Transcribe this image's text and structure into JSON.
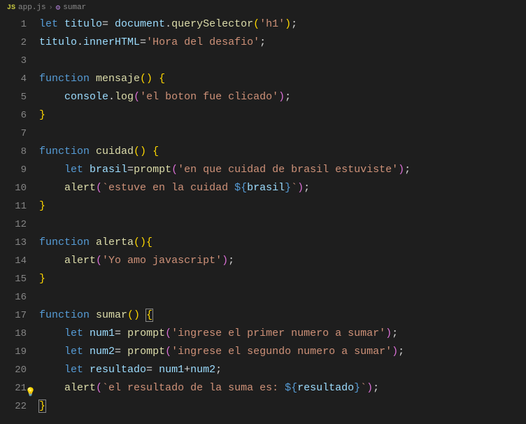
{
  "breadcrumb": {
    "file_icon": "JS",
    "file": "app.js",
    "sep": "›",
    "symbol_icon": "⚙",
    "symbol": "sumar"
  },
  "gutter": {
    "lines": [
      "1",
      "2",
      "3",
      "4",
      "5",
      "6",
      "7",
      "8",
      "9",
      "10",
      "11",
      "12",
      "13",
      "14",
      "15",
      "16",
      "17",
      "18",
      "19",
      "20",
      "21",
      "22"
    ]
  },
  "code": {
    "l1": {
      "let": "let ",
      "titulo": "titulo",
      "eq": "= ",
      "document": "document",
      "dot": ".",
      "qs": "querySelector",
      "lp": "(",
      "str": "'h1'",
      "rp": ")",
      "semi": ";"
    },
    "l2": {
      "titulo": "titulo",
      "dot": ".",
      "inner": "innerHTML",
      "eq": "=",
      "str": "'Hora del desafio'",
      "semi": ";"
    },
    "l4": {
      "fn": "function ",
      "name": "mensaje",
      "lp": "()",
      "sp": " ",
      "lb": "{"
    },
    "l5": {
      "indent": "    ",
      "console": "console",
      "dot": ".",
      "log": "log",
      "lp": "(",
      "str": "'el boton fue clicado'",
      "rp": ")",
      "semi": ";"
    },
    "l6": {
      "rb": "}"
    },
    "l8": {
      "fn": "function ",
      "name": "cuidad",
      "lp": "()",
      "sp": " ",
      "lb": "{"
    },
    "l9": {
      "indent": "    ",
      "let": "let ",
      "var": "brasil",
      "eq": "=",
      "prompt": "prompt",
      "lp": "(",
      "str": "'en que cuidad de brasil estuviste'",
      "rp": ")",
      "semi": ";"
    },
    "l10": {
      "indent": "    ",
      "alert": "alert",
      "lp": "(",
      "bt1": "`estuve en la cuidad ",
      "dl": "${",
      "var": "brasil",
      "dr": "}",
      "bt2": "`",
      "rp": ")",
      "semi": ";"
    },
    "l11": {
      "rb": "}"
    },
    "l13": {
      "fn": "function ",
      "name": "alerta",
      "lp": "()",
      "lb": "{"
    },
    "l14": {
      "indent": "    ",
      "alert": "alert",
      "lp": "(",
      "str": "'Yo amo javascript'",
      "rp": ")",
      "semi": ";"
    },
    "l15": {
      "rb": "}"
    },
    "l17": {
      "fn": "function ",
      "name": "sumar",
      "lp": "()",
      "sp": " ",
      "lb": "{"
    },
    "l18": {
      "indent": "    ",
      "let": "let ",
      "var": "num1",
      "eq": "= ",
      "prompt": "prompt",
      "lp": "(",
      "str": "'ingrese el primer numero a sumar'",
      "rp": ")",
      "semi": ";"
    },
    "l19": {
      "indent": "    ",
      "let": "let ",
      "var": "num2",
      "eq": "= ",
      "prompt": "prompt",
      "lp": "(",
      "str": "'ingrese el segundo numero a sumar'",
      "rp": ")",
      "semi": ";"
    },
    "l20": {
      "indent": "    ",
      "let": "let ",
      "var": "resultado",
      "eq": "= ",
      "n1": "num1",
      "plus": "+",
      "n2": "num2",
      "semi": ";"
    },
    "l21": {
      "indent": "    ",
      "alert": "alert",
      "lp": "(",
      "bt1": "`el resultado de la suma es: ",
      "dl": "${",
      "var": "resultado",
      "dr": "}",
      "bt2": "`",
      "rp": ")",
      "semi": ";"
    },
    "l22": {
      "rb": "}"
    }
  },
  "lightbulb": "💡"
}
